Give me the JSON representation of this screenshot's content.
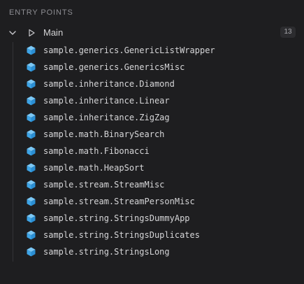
{
  "section": {
    "title": "ENTRY POINTS"
  },
  "group": {
    "label": "Main",
    "count": "13",
    "expanded_icon": "chevron-down-icon",
    "run_icon": "play-icon"
  },
  "items": [
    {
      "label": "sample.generics.GenericListWrapper",
      "icon": "class-cube-icon"
    },
    {
      "label": "sample.generics.GenericsMisc",
      "icon": "class-cube-icon"
    },
    {
      "label": "sample.inheritance.Diamond",
      "icon": "class-cube-icon"
    },
    {
      "label": "sample.inheritance.Linear",
      "icon": "class-cube-icon"
    },
    {
      "label": "sample.inheritance.ZigZag",
      "icon": "class-cube-icon"
    },
    {
      "label": "sample.math.BinarySearch",
      "icon": "class-cube-icon"
    },
    {
      "label": "sample.math.Fibonacci",
      "icon": "class-cube-icon"
    },
    {
      "label": "sample.math.HeapSort",
      "icon": "class-cube-icon"
    },
    {
      "label": "sample.stream.StreamMisc",
      "icon": "class-cube-icon"
    },
    {
      "label": "sample.stream.StreamPersonMisc",
      "icon": "class-cube-icon"
    },
    {
      "label": "sample.string.StringsDummyApp",
      "icon": "class-cube-icon"
    },
    {
      "label": "sample.string.StringsDuplicates",
      "icon": "class-cube-icon"
    },
    {
      "label": "sample.string.StringsLong",
      "icon": "class-cube-icon"
    }
  ],
  "colors": {
    "background": "#1e1e20",
    "cube_icon": "#4fb3f0",
    "text": "#d6d6d8",
    "muted": "#8e8e93"
  }
}
